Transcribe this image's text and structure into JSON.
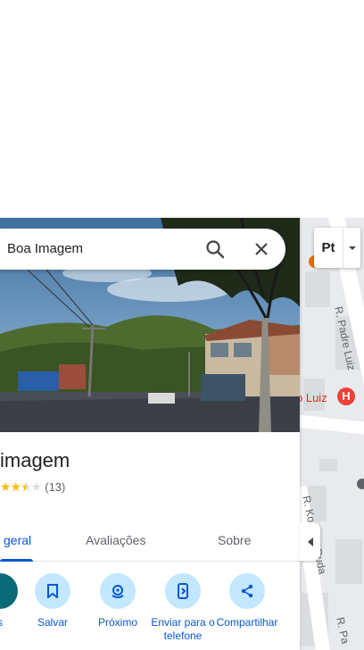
{
  "search": {
    "query": "Boa Imagem"
  },
  "place": {
    "name": "imagem",
    "rating_value": 3.5,
    "review_count": "(13)"
  },
  "tabs": [
    {
      "label": "geral",
      "active": true
    },
    {
      "label": "Avaliações",
      "active": false
    },
    {
      "label": "Sobre",
      "active": false
    }
  ],
  "actions": [
    {
      "label": "s",
      "icon": "directions-icon"
    },
    {
      "label": "Salvar",
      "icon": "bookmark-icon"
    },
    {
      "label": "Próximo",
      "icon": "nearby-icon"
    },
    {
      "label": "Enviar para o telefone",
      "icon": "send-to-phone-icon"
    },
    {
      "label": "Compartilhar",
      "icon": "share-icon"
    }
  ],
  "map": {
    "layer_button": "Pt",
    "street_padre": "R. Padre Luiz",
    "hospital_label": "o Luiz",
    "street_duda": "R. Kotlh W Duda",
    "street_pa": "R. Pa"
  },
  "colors": {
    "accent": "#0b57d0",
    "chip_bg": "#c2e7ff",
    "star": "#fbbc04",
    "hospital": "#ea4335",
    "map_bg": "#e8eaed"
  }
}
